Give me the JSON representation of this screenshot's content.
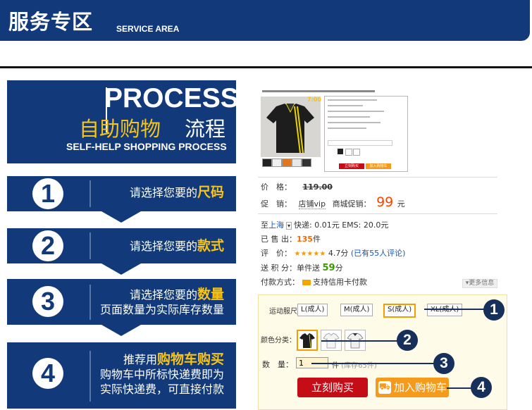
{
  "header": {
    "title": "服务专区",
    "subtitle": "SERVICE AREA"
  },
  "process": {
    "title_en": "PROCESS",
    "title_cn_highlight": "自助购物",
    "title_cn": "流程",
    "subtitle_en": "SELF-HELP SHOPPING PROCESS",
    "steps": [
      {
        "number": "1",
        "text": "请选择您要的",
        "highlight": "尺码",
        "extra": ""
      },
      {
        "number": "2",
        "text": "请选择您要的",
        "highlight": "款式",
        "extra": ""
      },
      {
        "number": "3",
        "text": "请选择您要的",
        "highlight": "数量",
        "extra": "页面数量为实际库存数量"
      },
      {
        "number": "4",
        "text": "推荐用",
        "highlight": "购物车购买",
        "extra": "购物车中所标快递费即为实际快递费，可直接付款"
      }
    ]
  },
  "product": {
    "price_label": "价　格：",
    "price_original": "119.00",
    "promo_label": "促　销：",
    "promo_tag": "店铺vip",
    "promo_text": "商城促销：",
    "promo_price": "99",
    "currency": "元",
    "shipping_to": "至",
    "shipping_city": "上海",
    "shipping_info": "快递: 0.01元    EMS: 20.0元",
    "sold_label": "已 售 出：",
    "sold_count": "135",
    "sold_unit": "件",
    "rating_label": "评　价：",
    "rating_value": "4.7分",
    "rating_reviews": "(已有55人评论)",
    "points_label": "送 积 分：",
    "points_prefix": "单件送",
    "points_value": "59",
    "points_unit": "分",
    "payment_label": "付款方式：",
    "payment_text": "支持信用卡付款",
    "more_info": "更多信息",
    "size_label": "运动服尺寸：",
    "sizes": [
      "L(成人)",
      "M(成人)",
      "S(成人)",
      "XL(成人)"
    ],
    "color_label": "颜色分类：",
    "qty_label": "数　量：",
    "qty_value": "1",
    "qty_unit": "件",
    "qty_stock": "(库存65件)",
    "buy_now": "立刻购买",
    "add_cart": "加入购物车"
  },
  "callouts": [
    "1",
    "2",
    "3",
    "4"
  ],
  "mini": {
    "buy_now": "立刻购买",
    "add_cart": "加入购物车",
    "price_tag": "7:00"
  }
}
